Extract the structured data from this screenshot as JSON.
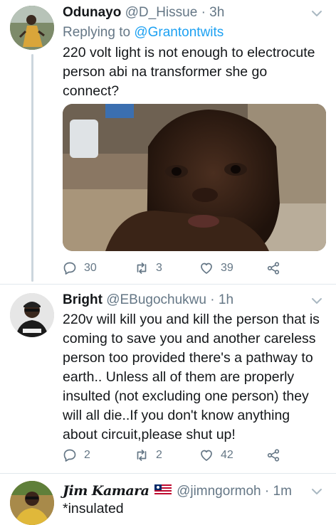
{
  "tweets": [
    {
      "name": "Odunayo",
      "handle": "@D_Hissue",
      "separator": "·",
      "time": "3h",
      "replying_prefix": "Replying to",
      "replying_to": "@Grantontwits",
      "lines": [
        "220 volt light is not enough to electrocute",
        "person abi na transformer she go",
        "connect?"
      ],
      "has_media": true,
      "counts": {
        "replies": "30",
        "retweets": "3",
        "likes": "39"
      }
    },
    {
      "name": "Bright",
      "handle": "@EBugochukwu",
      "separator": "·",
      "time": "1h",
      "lines": [
        "220v will kill you and kill the person that is",
        "coming to save you and another careless",
        "person too provided there's a pathway to",
        "earth.. Unless all of them are properly",
        "insulted (not excluding one person) they",
        "will all die..If you don't know anything",
        "about circuit,please shut up!"
      ],
      "counts": {
        "replies": "2",
        "retweets": "2",
        "likes": "42"
      }
    },
    {
      "name": "Jim Kamara",
      "handle": "@jimngormoh",
      "separator": "·",
      "time": "1m",
      "lines": [
        "*insulated"
      ]
    }
  ],
  "colors": {
    "accent": "#1da1f2",
    "secondary_text": "#657786",
    "divider": "#e1e8ed",
    "thread_line": "#ccd6dd"
  },
  "icons": {
    "reply": "reply-icon",
    "retweet": "retweet-icon",
    "like": "heart-icon",
    "share": "share-icon",
    "more": "chevron-down-icon",
    "flag": "liberia-flag-icon"
  }
}
